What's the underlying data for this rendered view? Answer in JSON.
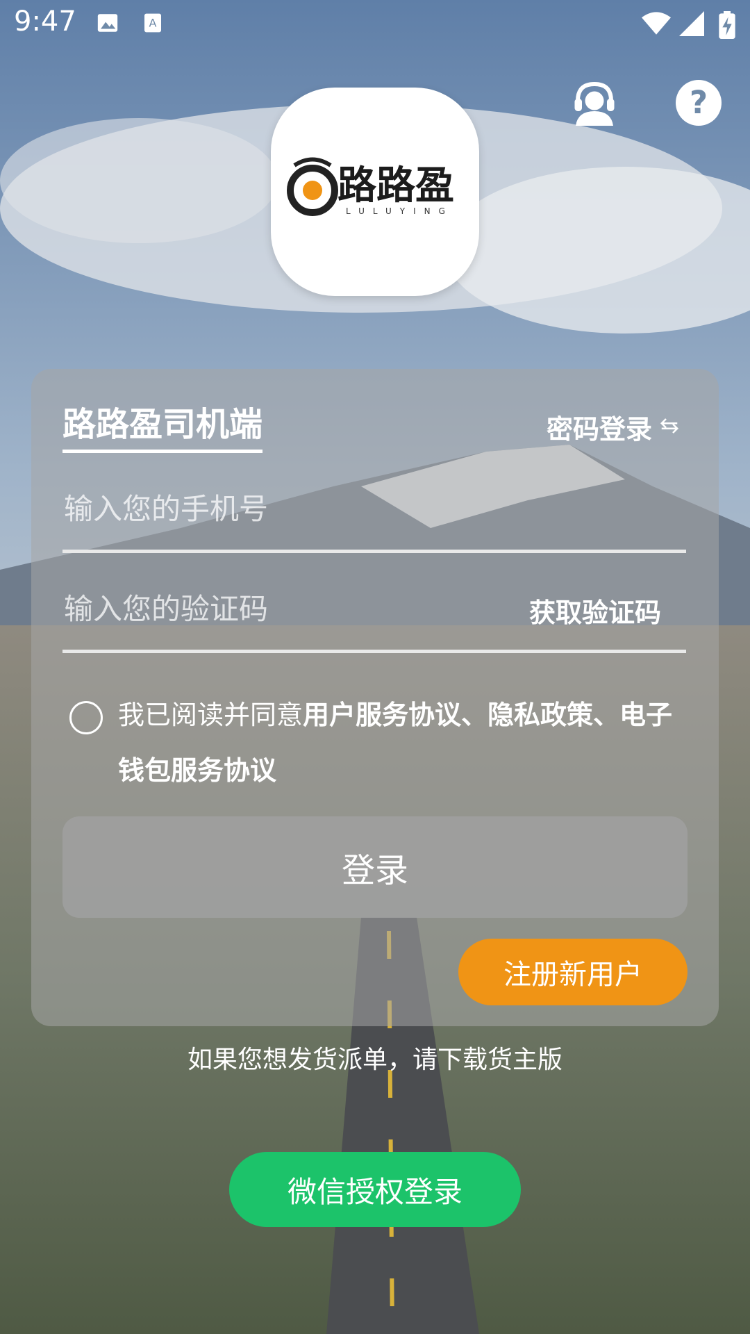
{
  "status_bar": {
    "time": "9:47"
  },
  "logo": {
    "brand_cn": "路路盈",
    "brand_en": "LULUYING"
  },
  "card": {
    "title": "路路盈司机端",
    "switch_login_label": "密码登录",
    "phone_placeholder": "输入您的手机号",
    "code_placeholder": "输入您的验证码",
    "get_code_label": "获取验证码",
    "agreement_prefix": "我已阅读并同意",
    "agreement_links": "用户服务协议、隐私政策、电子钱包服务协议",
    "login_label": "登录",
    "register_label": "注册新用户"
  },
  "hint_text": "如果您想发货派单，请下载货主版",
  "wechat_login_label": "微信授权登录",
  "colors": {
    "orange": "#f09415",
    "green": "#1cc36a"
  }
}
